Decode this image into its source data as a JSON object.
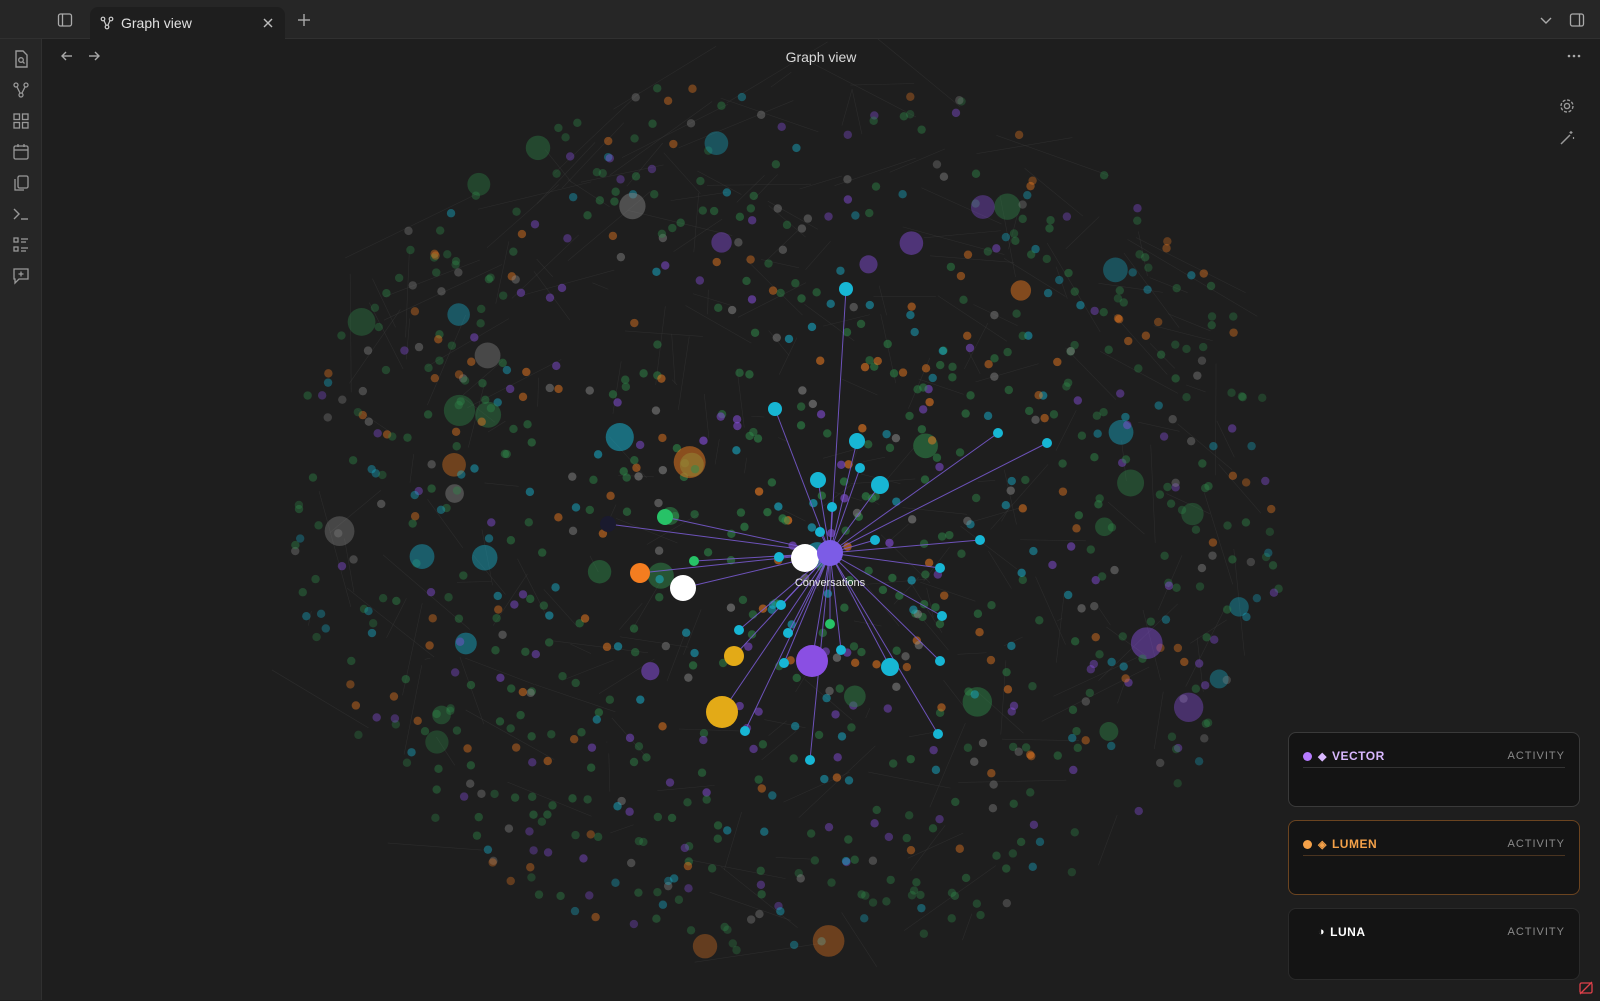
{
  "tab": {
    "label": "Graph view",
    "icon": "graph-icon"
  },
  "view": {
    "title": "Graph view"
  },
  "ribbon": [
    "file-search-icon",
    "graph-icon",
    "grid-icon",
    "calendar-icon",
    "copy-icon",
    "terminal-icon",
    "list-icon",
    "message-plus-icon"
  ],
  "graph": {
    "center_label": "Conversations",
    "colors": {
      "green": "#2f8a4a",
      "cyan": "#17b6d4",
      "orange": "#f47d20",
      "purple": "#8a4fe3",
      "white": "#ffffff",
      "yellow": "#e3aa17",
      "gray": "#8a8a8a",
      "link": "#7b5cd6"
    }
  },
  "panels": [
    {
      "name": "VECTOR",
      "activity": "ACTIVITY",
      "color": "#b67bff",
      "glyph": "◆"
    },
    {
      "name": "LUMEN",
      "activity": "ACTIVITY",
      "color": "#f4a149",
      "glyph": "◈"
    },
    {
      "name": "LUNA",
      "activity": "ACTIVITY",
      "color": "#ffffff",
      "glyph": "◑"
    }
  ]
}
